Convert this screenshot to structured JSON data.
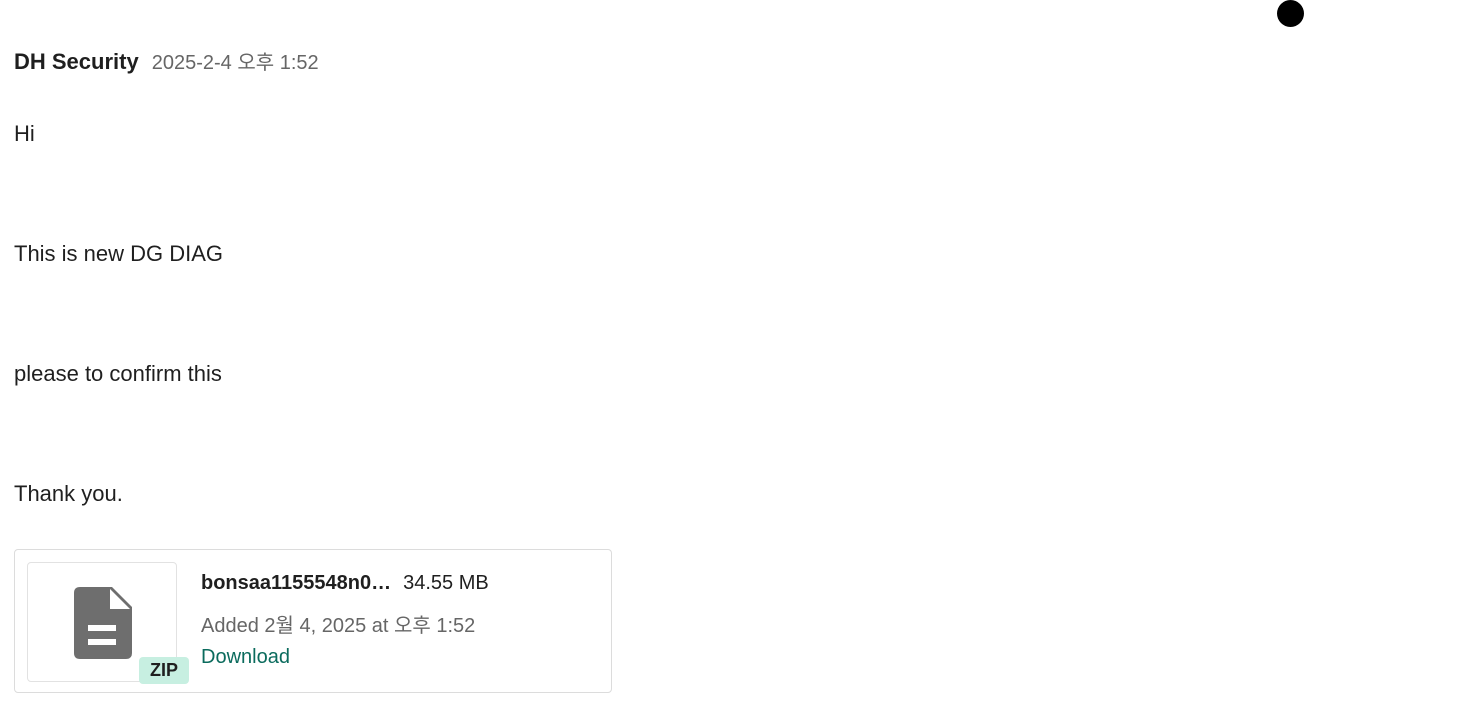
{
  "message": {
    "sender": "DH Security",
    "timestamp": "2025-2-4 오후 1:52",
    "body_lines": [
      "Hi",
      "This is new DG DIAG",
      "please to confirm this",
      "Thank you."
    ]
  },
  "attachment": {
    "file_name": "bonsaa1155548n0…",
    "file_size": "34.55 MB",
    "added_text": "Added 2월 4, 2025 at 오후 1:52",
    "download_label": "Download",
    "type_badge": "ZIP",
    "icon": "document-icon"
  },
  "colors": {
    "badge_bg": "#c7efe1",
    "link": "#0b6b5d",
    "muted_text": "#666666",
    "icon_gray": "#6e6e6e"
  }
}
